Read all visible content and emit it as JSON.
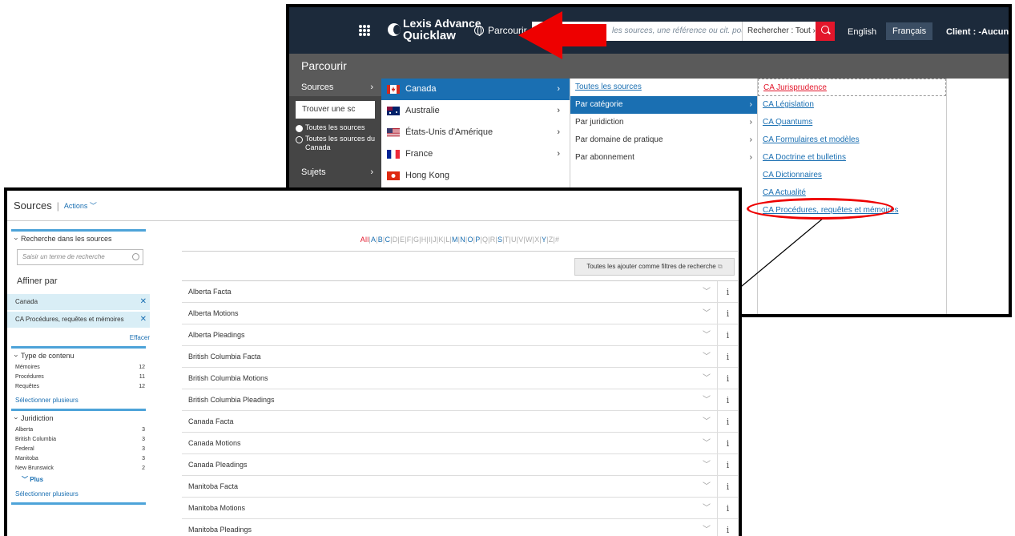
{
  "back": {
    "logo": {
      "line1": "Lexis Advance",
      "line2": "Quicklaw"
    },
    "nav_browse": "Parcourir",
    "search": {
      "placeholder": "les sources, une référence ou cit. pour recherch",
      "scope": "Rechercher : Tout  ›"
    },
    "lang_en": "English",
    "lang_fr": "Français",
    "client": "Client : -Aucun-",
    "page_title": "Parcourir",
    "col1": {
      "sources": "Sources",
      "find_placeholder": "Trouver une sc",
      "radio1": "Toutes les sources",
      "radio2": "Toutes les sources du Canada",
      "sujets": "Sujets"
    },
    "countries": [
      "Canada",
      "Australie",
      "États-Unis d'Amérique",
      "France",
      "Hong Kong"
    ],
    "categories": [
      "Toutes les sources",
      "Par catégorie",
      "Par juridiction",
      "Par domaine de pratique",
      "Par abonnement"
    ],
    "ca_links": [
      "CA Jurisprudence",
      "CA Législation",
      "CA Quantums",
      "CA Formulaires et modèles",
      "CA Doctrine et bulletins",
      "CA Dictionnaires",
      "CA Actualité",
      "CA Procédures, requêtes et mémoires"
    ],
    "colors": {
      "accent": "#1a6fb2",
      "red": "#e3162b",
      "topbar": "#1c2a3b"
    }
  },
  "front": {
    "title": "Sources",
    "actions": "Actions",
    "search_within": "Recherche dans les sources",
    "search_placeholder": "Saisir un terme de recherche",
    "affiner": "Affiner par",
    "filters": [
      "Canada",
      "CA Procédures, requêtes et mémoires"
    ],
    "effacer": "Effacer",
    "content_type": {
      "heading": "Type de contenu",
      "items": [
        {
          "label": "Mémoires",
          "count": "12"
        },
        {
          "label": "Procédures",
          "count": "11"
        },
        {
          "label": "Requêtes",
          "count": "12"
        }
      ],
      "select_many": "Sélectionner plusieurs"
    },
    "jurisdiction": {
      "heading": "Juridiction",
      "items": [
        {
          "label": "Alberta",
          "count": "3"
        },
        {
          "label": "British Columbia",
          "count": "3"
        },
        {
          "label": "Federal",
          "count": "3"
        },
        {
          "label": "Manitoba",
          "count": "3"
        },
        {
          "label": "New Brunswick",
          "count": "2"
        }
      ],
      "more": "Plus",
      "select_many": "Sélectionner plusieurs"
    },
    "alphabet": {
      "all": "All",
      "letters": [
        "A",
        "B",
        "C",
        "D",
        "E",
        "F",
        "G",
        "H",
        "I",
        "J",
        "K",
        "L",
        "M",
        "N",
        "O",
        "P",
        "Q",
        "R",
        "S",
        "T",
        "U",
        "V",
        "W",
        "X",
        "Y",
        "Z",
        "#"
      ],
      "active": [
        "A",
        "B",
        "C",
        "M",
        "N",
        "O",
        "P",
        "S",
        "Y"
      ]
    },
    "add_all": "Toutes les ajouter comme filtres de recherche",
    "results": [
      "Alberta Facta",
      "Alberta Motions",
      "Alberta Pleadings",
      "British Columbia Facta",
      "British Columbia Motions",
      "British Columbia Pleadings",
      "Canada Facta",
      "Canada Motions",
      "Canada Pleadings",
      "Manitoba Facta",
      "Manitoba Motions",
      "Manitoba Pleadings"
    ]
  }
}
